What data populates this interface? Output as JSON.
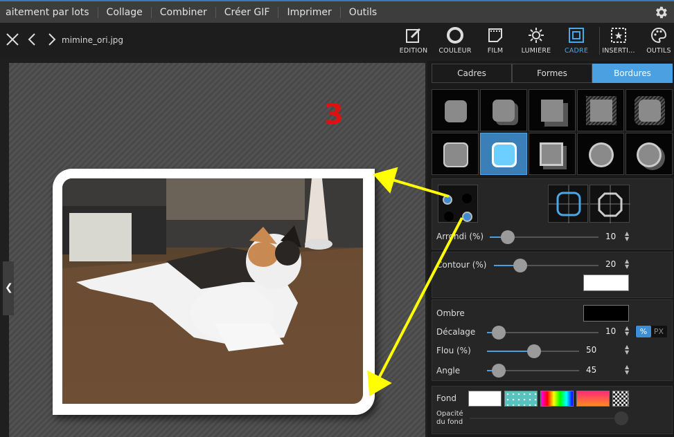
{
  "menu": {
    "items": [
      "aitement par lots",
      "Collage",
      "Combiner",
      "Créer GIF",
      "Imprimer",
      "Outils"
    ]
  },
  "toolbar": {
    "filename": "mimine_ori.jpg",
    "tools": [
      {
        "label": "EDITION",
        "icon": "edit-icon"
      },
      {
        "label": "COULEUR",
        "icon": "color-icon"
      },
      {
        "label": "FILM",
        "icon": "film-icon"
      },
      {
        "label": "LUMIÈRE",
        "icon": "light-icon"
      },
      {
        "label": "CADRE",
        "icon": "frame-icon",
        "active": true
      },
      {
        "label": "INSERTI...",
        "icon": "insert-icon"
      },
      {
        "label": "OUTILS",
        "icon": "palette-icon"
      }
    ]
  },
  "canvas": {
    "step_number": "3"
  },
  "panel": {
    "tabs": [
      "Cadres",
      "Formes",
      "Bordures"
    ],
    "active_tab": "Bordures",
    "arrondi": {
      "label": "Arrondi (%)",
      "value": "10"
    },
    "contour": {
      "label": "Contour (%)",
      "value": "20",
      "color": "#ffffff"
    },
    "ombre": {
      "label": "Ombre",
      "color": "#000000",
      "decalage": {
        "label": "Décalage",
        "value": "10"
      },
      "flou": {
        "label": "Flou (%)",
        "value": "50"
      },
      "angle": {
        "label": "Angle",
        "value": "45"
      },
      "unit_percent": "%",
      "unit_px": "PX"
    },
    "fond": {
      "label": "Fond"
    },
    "opacite": {
      "label_line1": "Opacité",
      "label_line2": "du fond"
    }
  },
  "colors": {
    "accent": "#4aa0e0",
    "arrow": "#ffff00",
    "step_number": "#e01010"
  }
}
